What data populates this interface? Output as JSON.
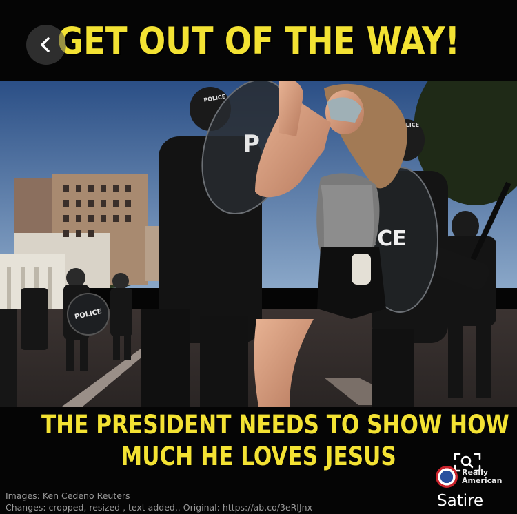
{
  "meme": {
    "top_caption": "GET OUT OF THE WAY!",
    "bottom_caption_line1": "THE PRESIDENT NEEDS TO SHOW HOW",
    "bottom_caption_line2": "MUCH HE LOVES JESUS",
    "caption_color": "#f3e233"
  },
  "photo": {
    "shield_text_left": "POLICE",
    "shield_text_right": "ICE",
    "helmet_text": "POLICE",
    "helmet_text_right": "POLICE",
    "shield_letter": "P"
  },
  "credits": {
    "line1": "Images: Ken Cedeno Reuters",
    "line2": "Changes: cropped, resized , text added,. Original: https://ab.co/3eRIJnx"
  },
  "brand": {
    "name_line1": "Really",
    "name_line2": "American",
    "tag": "Satire"
  },
  "controls": {
    "back_icon": "chevron-left-icon",
    "zoom_icon": "zoom-icon"
  }
}
